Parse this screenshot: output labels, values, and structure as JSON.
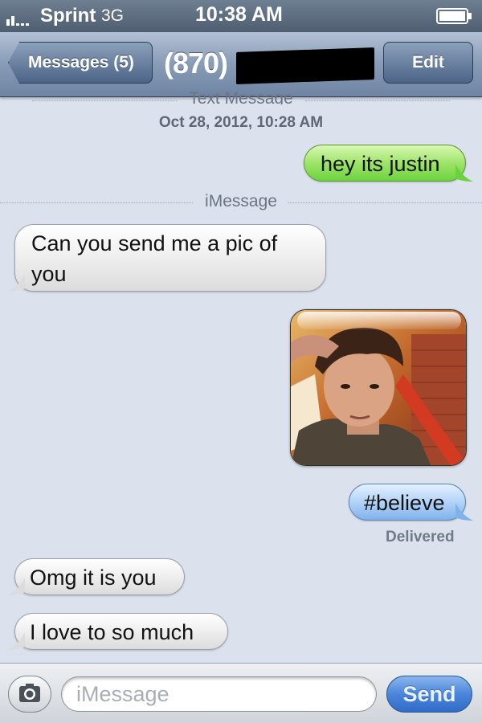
{
  "status_bar": {
    "carrier": "Sprint",
    "network": "3G",
    "time": "10:38 AM"
  },
  "nav": {
    "back_label": "Messages (5)",
    "title": "(870)",
    "edit_label": "Edit"
  },
  "thread": {
    "service_label_sms": "Text Message",
    "timestamp": "Oct 28, 2012, 10:28 AM",
    "service_label_imessage": "iMessage",
    "messages": [
      {
        "direction": "outgoing",
        "service": "sms",
        "text": "hey its justin"
      },
      {
        "direction": "incoming",
        "text": "Can you send me a pic of you"
      },
      {
        "direction": "outgoing",
        "type": "photo"
      },
      {
        "direction": "outgoing",
        "service": "imessage",
        "text": "#believe"
      },
      {
        "direction": "incoming",
        "text": "Omg it is you"
      },
      {
        "direction": "incoming",
        "text": "I love to so much"
      }
    ],
    "delivery_status": "Delivered"
  },
  "input_bar": {
    "placeholder": "iMessage",
    "send_label": "Send"
  },
  "icons": {
    "signal": "signal-bars-icon",
    "battery": "battery-icon",
    "camera": "camera-icon",
    "back": "back-chevron-icon"
  },
  "colors": {
    "outgoing_sms": "#8fdf5c",
    "outgoing_imessage": "#9cc4f2",
    "incoming": "#ececec",
    "nav_bar": "#8a9cb6",
    "send_button": "#4a86db"
  }
}
